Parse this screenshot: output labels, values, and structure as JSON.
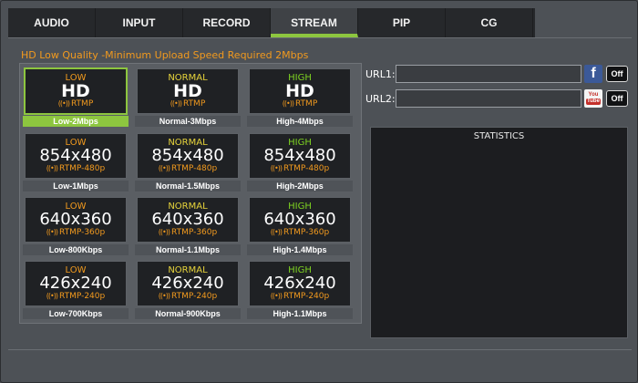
{
  "tabs": [
    {
      "label": "AUDIO",
      "active": false
    },
    {
      "label": "INPUT",
      "active": false
    },
    {
      "label": "RECORD",
      "active": false
    },
    {
      "label": "STREAM",
      "active": true
    },
    {
      "label": "PIP",
      "active": false
    },
    {
      "label": "CG",
      "active": false
    }
  ],
  "quality_heading": "HD Low Quality -Minimum Upload Speed Required 2Mbps",
  "presets": [
    [
      {
        "tier": "LOW",
        "res": "HD",
        "proto": "RTMP",
        "label": "Low-2Mbps"
      },
      {
        "tier": "NORMAL",
        "res": "HD",
        "proto": "RTMP",
        "label": "Normal-3Mbps"
      },
      {
        "tier": "HIGH",
        "res": "HD",
        "proto": "RTMP",
        "label": "High-4Mbps"
      }
    ],
    [
      {
        "tier": "LOW",
        "res": "854x480",
        "proto": "RTMP-480p",
        "label": "Low-1Mbps"
      },
      {
        "tier": "NORMAL",
        "res": "854x480",
        "proto": "RTMP-480p",
        "label": "Normal-1.5Mbps"
      },
      {
        "tier": "HIGH",
        "res": "854x480",
        "proto": "RTMP-480p",
        "label": "High-2Mbps"
      }
    ],
    [
      {
        "tier": "LOW",
        "res": "640x360",
        "proto": "RTMP-360p",
        "label": "Low-800Kbps"
      },
      {
        "tier": "NORMAL",
        "res": "640x360",
        "proto": "RTMP-360p",
        "label": "Normal-1.1Mbps"
      },
      {
        "tier": "HIGH",
        "res": "640x360",
        "proto": "RTMP-360p",
        "label": "High-1.4Mbps"
      }
    ],
    [
      {
        "tier": "LOW",
        "res": "426x240",
        "proto": "RTMP-240p",
        "label": "Low-700Kbps"
      },
      {
        "tier": "NORMAL",
        "res": "426x240",
        "proto": "RTMP-240p",
        "label": "Normal-900Kbps"
      },
      {
        "tier": "HIGH",
        "res": "426x240",
        "proto": "RTMP-240p",
        "label": "High-1.1Mbps"
      }
    ]
  ],
  "selected_preset": "Low-2Mbps",
  "url1": {
    "label": "URL1:",
    "value": "",
    "service_icon": "facebook-icon",
    "button": "Off"
  },
  "url2": {
    "label": "URL2:",
    "value": "",
    "service_icon": "youtube-icon",
    "youtube_text_top": "You",
    "youtube_text_bottom": "Tube",
    "button": "Off"
  },
  "statistics": {
    "title": "STATISTICS"
  },
  "colors": {
    "accent_green": "#8dc63f",
    "low": "#f29a1e",
    "normal": "#e7d43b",
    "high": "#7ed321"
  }
}
